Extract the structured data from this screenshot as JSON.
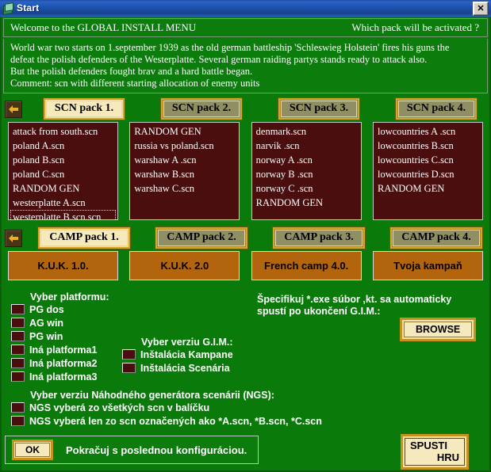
{
  "window": {
    "title": "Start",
    "icon": "app-icon",
    "close_label": "✕"
  },
  "banner": {
    "left": "Welcome to the  GLOBAL   INSTALL   MENU",
    "right": "Which  pack will be activated ?"
  },
  "description": {
    "line1": "World war two starts on 1.september 1939 as the old german battleship 'Schleswieg Holstein' fires his guns the",
    "line2": "defeat the polish defenders of the Westerplatte. Several german raiding partys stands ready to attack also.",
    "line3": "But the polish defenders fought brav and a hard battle began.",
    "line4": "Comment: scn  with different starting  allocation of enemy units"
  },
  "scn_row": {
    "prev_label": "◀",
    "next_label": "▶",
    "packs": [
      {
        "label": "SCN pack 1.",
        "selected": true
      },
      {
        "label": "SCN pack 2.",
        "selected": false
      },
      {
        "label": "SCN pack 3.",
        "selected": false
      },
      {
        "label": "SCN pack 4.",
        "selected": false
      }
    ]
  },
  "scn_lists": [
    {
      "items": [
        "attack from south.scn",
        "poland A.scn",
        "poland B.scn",
        "poland C.scn",
        "RANDOM GEN",
        "westerplatte A.scn",
        "westerplatte B.scn.scn"
      ],
      "focused_index": 6
    },
    {
      "items": [
        "RANDOM GEN",
        "russia vs poland.scn",
        "warshaw A .scn",
        "warshaw B.scn",
        "warshaw C.scn"
      ],
      "focused_index": -1
    },
    {
      "items": [
        "denmark.scn",
        "narvik .scn",
        "norway A .scn",
        "norway B .scn",
        "norway C .scn",
        "RANDOM GEN"
      ],
      "focused_index": -1
    },
    {
      "items": [
        "lowcountries A .scn",
        "lowcountries B.scn",
        "lowcountries C.scn",
        "lowcountries D.scn",
        "RANDOM GEN"
      ],
      "focused_index": -1
    }
  ],
  "camp_row": {
    "prev_label": "◀",
    "next_label": "▶",
    "packs": [
      {
        "label": "CAMP pack 1.",
        "selected": true
      },
      {
        "label": "CAMP pack 2.",
        "selected": false
      },
      {
        "label": "CAMP pack 3.",
        "selected": false
      },
      {
        "label": "CAMP pack 4.",
        "selected": false
      }
    ]
  },
  "camp_buttons": [
    "K.U.K. 1.0.",
    "K.U.K. 2.0",
    "French camp 4.0.",
    "Tvoja kampaň"
  ],
  "platform_group": {
    "title": "Vyber platformu:",
    "options": [
      "PG dos",
      "AG win",
      "PG win",
      "Iná platforma1",
      "Iná platforma2",
      "Iná platforma3"
    ]
  },
  "gim_group": {
    "title": "Vyber verziu G.I.M.:",
    "options": [
      "Inštalácia Kampane",
      "Inštalácia Scenária"
    ]
  },
  "exe_group": {
    "line1": "Špecifikuj *.exe súbor ,kt. sa  automaticky",
    "line2": "spustí po ukončení G.I.M.:",
    "browse_label": "BROWSE"
  },
  "ngs_group": {
    "title": "Vyber verziu Náhodného generátora scenárii (NGS):",
    "options": [
      "NGS vyberá zo všetkých scn v balíčku",
      "NGS vyberá len zo scn označených ako *A.scn, *B.scn, *C.scn"
    ]
  },
  "bottom": {
    "ok_label": "OK",
    "ok_text": "Pokračuj s poslednou konfiguráciou.",
    "spusti_line1": "SPUSTI",
    "spusti_line2": "HRU"
  },
  "colors": {
    "background_green": "#0a7a0a",
    "list_maroon": "#4a0e0e",
    "camp_orange": "#b3650e",
    "button_gold": "#c8911c",
    "button_face": "#f5e9bd",
    "titlebar_blue": "#1c51ae"
  }
}
